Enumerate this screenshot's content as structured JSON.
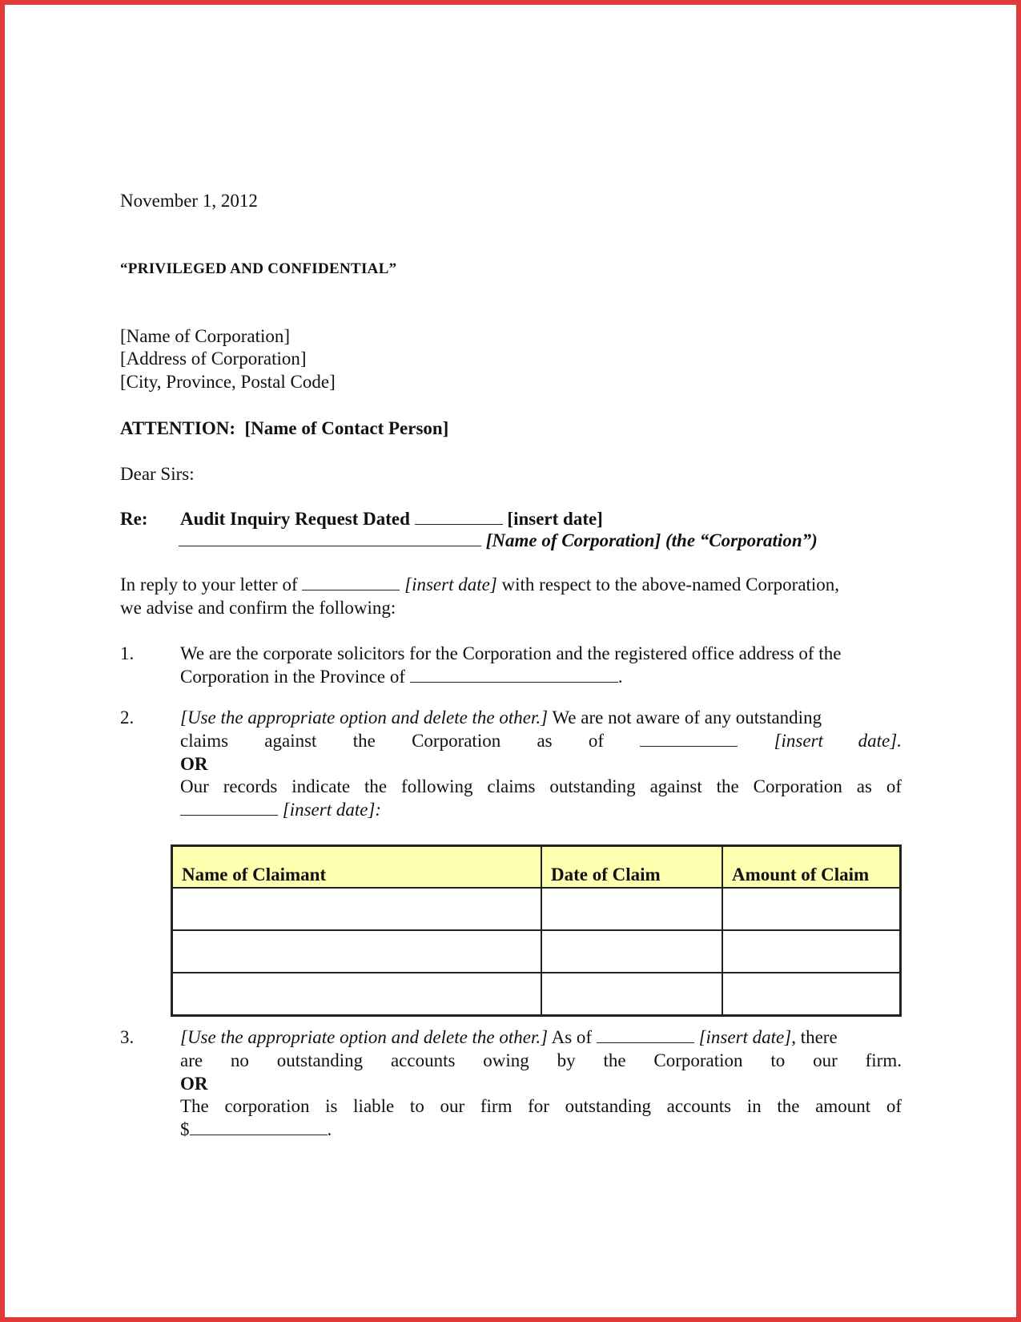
{
  "letter": {
    "date": "November 1, 2012",
    "privileged": "“PRIVILEGED AND CONFIDENTIAL”",
    "address": [
      "[Name of Corporation]",
      "[Address of Corporation]",
      "[City, Province, Postal Code]"
    ],
    "attention_label": "ATTENTION:",
    "attention_value": "[Name of Contact Person]",
    "salutation": "Dear Sirs:",
    "re": {
      "label": "Re:",
      "line1_text": "Audit Inquiry Request Dated",
      "line1_placeholder": "[insert date]",
      "line2_placeholder": "[Name of Corporation] (the “Corporation”)"
    },
    "intro": {
      "part1": "In reply to your letter of",
      "placeholder": "[insert date]",
      "part2": "with respect to the above-named Corporation,",
      "line2": "we advise and confirm the following:"
    },
    "items": [
      {
        "number": "1.",
        "line1": "We are the corporate solicitors for the Corporation and the registered office address of the",
        "line2": "Corporation in the Province of",
        "line2_end": "."
      },
      {
        "number": "2.",
        "instruction": "[Use the appropriate option and delete the other.]",
        "line1_rest": "We are not aware of any outstanding",
        "line2_words": [
          "claims",
          "against",
          "the",
          "Corporation",
          "as",
          "of"
        ],
        "line2_placeholder": "[insert date].",
        "or": "OR",
        "line4": "Our records indicate the following claims outstanding against the Corporation as of",
        "line5_placeholder": "[insert date]",
        "line5_end": ":"
      },
      {
        "number": "3.",
        "instruction": "[Use the appropriate option and delete the other.]",
        "line1_mid": "As of",
        "line1_placeholder": "[insert date]",
        "line1_end": ", there",
        "line2": "are no outstanding accounts owing by the Corporation to our firm.",
        "or": "OR",
        "line4": "The corporation is liable to our firm for outstanding accounts in the amount of",
        "line5_prefix": "$",
        "line5_end": "."
      }
    ],
    "claims_table": {
      "headers": [
        "Name of Claimant",
        "Date of Claim",
        "Amount of Claim"
      ],
      "rows": [
        [
          "",
          "",
          ""
        ],
        [
          "",
          "",
          ""
        ],
        [
          "",
          "",
          ""
        ]
      ]
    }
  },
  "colors": {
    "border": "#e03a3a",
    "table_header": "#ffffb0"
  }
}
